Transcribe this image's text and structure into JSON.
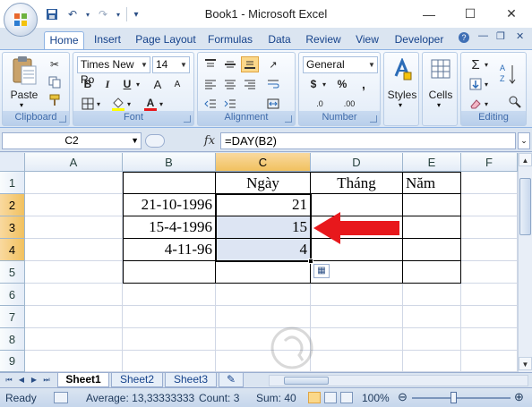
{
  "window": {
    "title": "Book1 - Microsoft Excel",
    "minimize_glyph": "—",
    "maximize_glyph": "☐",
    "close_glyph": "✕"
  },
  "quick_access": {
    "save_icon": "save-icon",
    "undo_glyph": "↶",
    "redo_glyph": "↷",
    "customize_glyph": "▾"
  },
  "tabs": [
    "Home",
    "Insert",
    "Page Layout",
    "Formulas",
    "Data",
    "Review",
    "View",
    "Developer"
  ],
  "ribbon_controls": {
    "help": "?",
    "min": "—",
    "restore": "❐",
    "close": "✕"
  },
  "ribbon": {
    "clipboard": {
      "label": "Clipboard",
      "paste_label": "Paste"
    },
    "font": {
      "label": "Font",
      "font_name": "Times New Ro",
      "font_size": "14",
      "bold": "B",
      "italic": "I",
      "underline": "U",
      "grow": "A",
      "shrink": "A",
      "font_color": "A"
    },
    "alignment": {
      "label": "Alignment"
    },
    "number": {
      "label": "Number",
      "format": "General",
      "currency": "$",
      "percent": "%",
      "comma": ",",
      "inc_decimal": ".0",
      "dec_decimal": ".00"
    },
    "styles": {
      "label": "Styles"
    },
    "cells": {
      "label": "Cells"
    },
    "editing": {
      "label": "Editing",
      "sum": "Σ"
    }
  },
  "formula_bar": {
    "name_box": "C2",
    "fx": "fx",
    "formula": "=DAY(B2)"
  },
  "grid": {
    "columns": [
      "A",
      "B",
      "C",
      "D",
      "E",
      "F"
    ],
    "rows": [
      "1",
      "2",
      "3",
      "4",
      "5",
      "6",
      "7",
      "8",
      "9"
    ],
    "cells": {
      "C1": "Ngày",
      "D1": "Tháng",
      "E1": "Năm",
      "B2": "21-10-1996",
      "C2": "21",
      "B3": "15-4-1996",
      "C3": "15",
      "B4": "4-11-96",
      "C4": "4"
    },
    "selected_range": "C2:C4",
    "colors": {
      "selection_fill": "#dde5f3",
      "arrow": "#e8181c",
      "header_selected": "#f6c96a"
    }
  },
  "sheets": {
    "tabs": [
      "Sheet1",
      "Sheet2",
      "Sheet3"
    ],
    "active": "Sheet1"
  },
  "status": {
    "mode": "Ready",
    "average": "Average: 13,33333333",
    "count": "Count: 3",
    "sum": "Sum: 40",
    "zoom": "100%",
    "zoom_minus": "⊖",
    "zoom_plus": "⊕"
  }
}
